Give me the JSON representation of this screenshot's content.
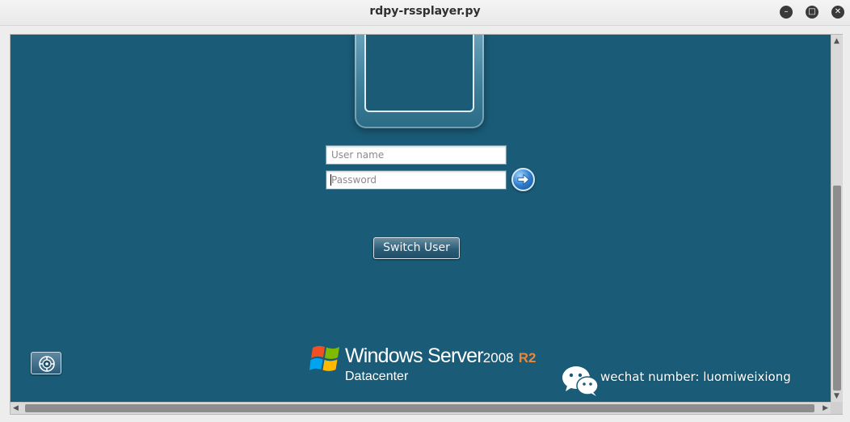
{
  "window": {
    "title": "rdpy-rssplayer.py",
    "controls": {
      "minimize": "–",
      "maximize": "□",
      "close": "✕"
    }
  },
  "login": {
    "username_placeholder": "User name",
    "password_placeholder": "Password",
    "submit_icon": "arrow-right-icon",
    "switch_user_label": "Switch User",
    "ease_of_access_icon": "ease-of-access-icon"
  },
  "branding": {
    "product": "Windows Server",
    "version": "2008",
    "release": "R2",
    "edition": "Datacenter",
    "logo_icon": "windows-flag-icon"
  },
  "watermark": {
    "icon": "wechat-icon",
    "text": "wechat number: luomiweixiong"
  },
  "colors": {
    "screen_background": "#1a5c78",
    "release_accent": "#e8883a"
  }
}
